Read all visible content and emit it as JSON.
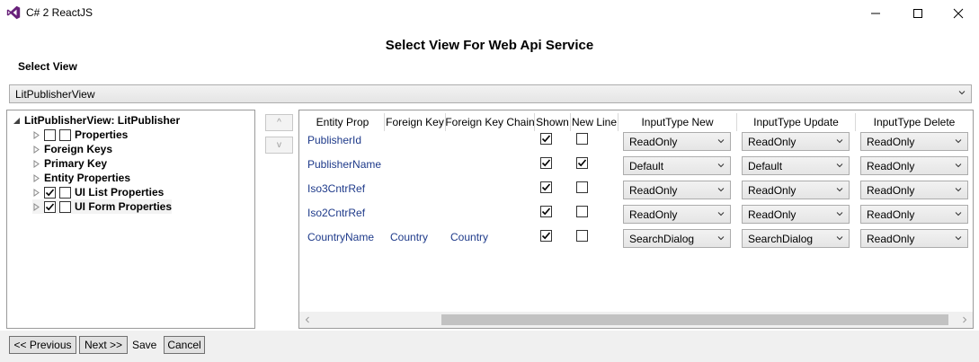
{
  "window": {
    "title": "C# 2 ReactJS",
    "controls": {
      "minimize_icon": "minimize-icon",
      "maximize_icon": "maximize-icon",
      "close_icon": "close-icon"
    }
  },
  "page": {
    "heading": "Select View For Web Api Service",
    "select_view_label": "Select View",
    "view_selected": "LitPublisherView"
  },
  "tree": {
    "root": "LitPublisherView: LitPublisher",
    "items": [
      {
        "label": "Properties",
        "checked_a": false,
        "checked_b": false
      },
      {
        "label": "Foreign Keys"
      },
      {
        "label": "Primary Key"
      },
      {
        "label": "Entity Properties"
      },
      {
        "label": "UI List Properties",
        "checked_a": true,
        "checked_b": false
      },
      {
        "label": "UI Form Properties",
        "checked_a": true,
        "checked_b": false
      }
    ]
  },
  "move_buttons": {
    "up": "^",
    "down": "v"
  },
  "grid": {
    "columns": [
      "Entity Prop",
      "Foreign Key",
      "Foreign Key Chain",
      "Shown",
      "New Line",
      "InputType New",
      "InputType Update",
      "InputType Delete"
    ],
    "rows": [
      {
        "entity_prop": "PublisherId",
        "foreign_key": "",
        "foreign_key_chain": "",
        "shown": true,
        "new_line": false,
        "new": "ReadOnly",
        "update": "ReadOnly",
        "delete": "ReadOnly"
      },
      {
        "entity_prop": "PublisherName",
        "foreign_key": "",
        "foreign_key_chain": "",
        "shown": true,
        "new_line": true,
        "new": "Default",
        "update": "Default",
        "delete": "ReadOnly"
      },
      {
        "entity_prop": "Iso3CntrRef",
        "foreign_key": "",
        "foreign_key_chain": "",
        "shown": true,
        "new_line": false,
        "new": "ReadOnly",
        "update": "ReadOnly",
        "delete": "ReadOnly"
      },
      {
        "entity_prop": "Iso2CntrRef",
        "foreign_key": "",
        "foreign_key_chain": "",
        "shown": true,
        "new_line": false,
        "new": "ReadOnly",
        "update": "ReadOnly",
        "delete": "ReadOnly"
      },
      {
        "entity_prop": "CountryName",
        "foreign_key": "Country",
        "foreign_key_chain": "Country",
        "shown": true,
        "new_line": false,
        "new": "SearchDialog",
        "update": "SearchDialog",
        "delete": "ReadOnly"
      }
    ]
  },
  "footer": {
    "previous": "<< Previous",
    "next": "Next >>",
    "save": "Save",
    "cancel": "Cancel"
  },
  "colors": {
    "accent": "#1e3a8a",
    "vs_purple": "#68217a"
  }
}
